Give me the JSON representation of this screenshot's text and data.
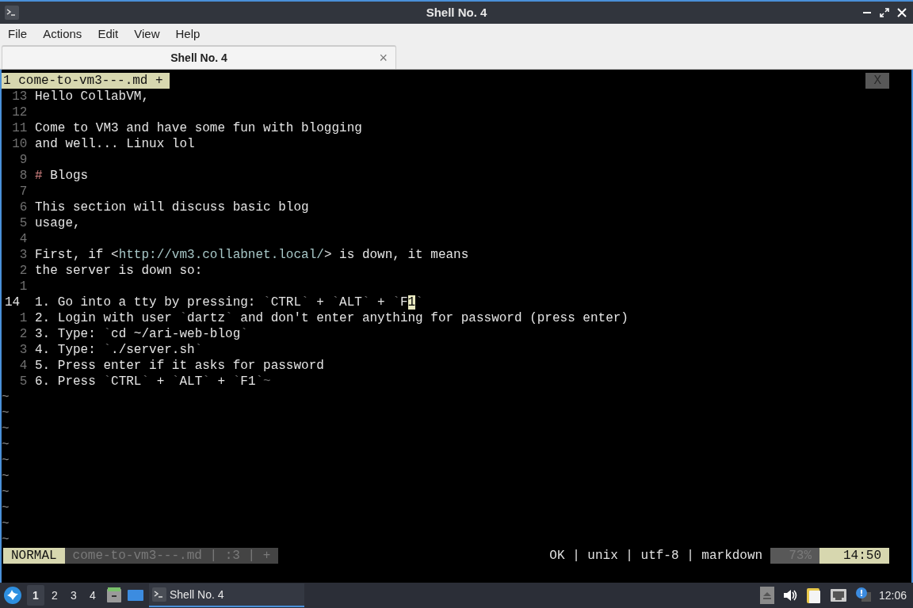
{
  "window": {
    "title": "Shell No. 4"
  },
  "menu": [
    "File",
    "Actions",
    "Edit",
    "View",
    "Help"
  ],
  "tabs": [
    {
      "label": "Shell No. 4",
      "selected": true,
      "close": "×"
    }
  ],
  "vim": {
    "buffers": [
      {
        "label": "1 come-to-vm3---.md +",
        "selected": true
      }
    ],
    "close_label": "X",
    "lines": [
      {
        "number": "13",
        "current": false,
        "segments": [
          {
            "kind": "text",
            "text": "Hello CollabVM,"
          }
        ]
      },
      {
        "number": "12",
        "current": false
      },
      {
        "number": "11",
        "current": false,
        "segments": [
          {
            "kind": "text",
            "text": "Come to VM3 and have some fun with blogging"
          }
        ]
      },
      {
        "number": "10",
        "current": false,
        "segments": [
          {
            "kind": "text",
            "text": "and well... Linux lol"
          }
        ]
      },
      {
        "number": "9",
        "current": false
      },
      {
        "number": "8",
        "current": false,
        "segments": [
          {
            "kind": "heading-mark",
            "text": "#"
          },
          {
            "kind": "text",
            "text": " Blogs"
          }
        ]
      },
      {
        "number": "7",
        "current": false
      },
      {
        "number": "6",
        "current": false,
        "segments": [
          {
            "kind": "text",
            "text": "This section will discuss basic blog"
          }
        ]
      },
      {
        "number": "5",
        "current": false,
        "segments": [
          {
            "kind": "text",
            "text": "usage,"
          }
        ]
      },
      {
        "number": "4",
        "current": false
      },
      {
        "number": "3",
        "current": false,
        "segments": [
          {
            "kind": "text",
            "text": "First, if <"
          },
          {
            "kind": "url",
            "text": "http://vm3.collabnet.local/"
          },
          {
            "kind": "text",
            "text": "> is down, it means"
          }
        ]
      },
      {
        "number": "2",
        "current": false,
        "segments": [
          {
            "kind": "text",
            "text": "the server is down so:"
          }
        ]
      },
      {
        "number": "1",
        "current": false
      },
      {
        "number": "14",
        "current": true,
        "segments": [
          {
            "kind": "text",
            "text": "1. Go into a tty by pressing: "
          },
          {
            "kind": "tick",
            "text": "`"
          },
          {
            "kind": "text",
            "text": "CTRL"
          },
          {
            "kind": "tick",
            "text": "`"
          },
          {
            "kind": "text",
            "text": " + "
          },
          {
            "kind": "tick",
            "text": "`"
          },
          {
            "kind": "text",
            "text": "ALT"
          },
          {
            "kind": "tick",
            "text": "`"
          },
          {
            "kind": "text",
            "text": " + "
          },
          {
            "kind": "tick",
            "text": "`"
          },
          {
            "kind": "text",
            "text": "F"
          },
          {
            "kind": "cursor",
            "text": "1"
          },
          {
            "kind": "tick",
            "text": "`"
          }
        ]
      },
      {
        "number": "1",
        "current": false,
        "segments": [
          {
            "kind": "text",
            "text": "2. Login with user "
          },
          {
            "kind": "tick",
            "text": "`"
          },
          {
            "kind": "text",
            "text": "dartz"
          },
          {
            "kind": "tick",
            "text": "`"
          },
          {
            "kind": "text",
            "text": " and don't enter anything for password (press enter)"
          }
        ]
      },
      {
        "number": "2",
        "current": false,
        "segments": [
          {
            "kind": "text",
            "text": "3. Type: "
          },
          {
            "kind": "tick",
            "text": "`"
          },
          {
            "kind": "text",
            "text": "cd ~/ari-web-blog"
          },
          {
            "kind": "tick",
            "text": "`"
          }
        ]
      },
      {
        "number": "3",
        "current": false,
        "segments": [
          {
            "kind": "text",
            "text": "4. Type: "
          },
          {
            "kind": "tick",
            "text": "`"
          },
          {
            "kind": "text",
            "text": "./server.sh"
          },
          {
            "kind": "tick",
            "text": "`"
          }
        ]
      },
      {
        "number": "4",
        "current": false,
        "segments": [
          {
            "kind": "text",
            "text": "5. Press enter if it asks for password"
          }
        ]
      },
      {
        "number": "5",
        "current": false,
        "segments": [
          {
            "kind": "text",
            "text": "6. Press "
          },
          {
            "kind": "tick",
            "text": "`"
          },
          {
            "kind": "text",
            "text": "CTRL"
          },
          {
            "kind": "tick",
            "text": "`"
          },
          {
            "kind": "text",
            "text": " + "
          },
          {
            "kind": "tick",
            "text": "`"
          },
          {
            "kind": "text",
            "text": "ALT"
          },
          {
            "kind": "tick",
            "text": "`"
          },
          {
            "kind": "text",
            "text": " + "
          },
          {
            "kind": "tick",
            "text": "`"
          },
          {
            "kind": "text",
            "text": "F1"
          },
          {
            "kind": "tick",
            "text": "`~"
          }
        ]
      }
    ],
    "filler": [
      "~",
      "~",
      "~",
      "~",
      "~",
      "~",
      "~",
      "~",
      "~",
      "~"
    ],
    "statusline": {
      "mode": "NORMAL",
      "file": "come-to-vm3---.md | :3 | +",
      "info": "OK | unix | utf-8 | markdown",
      "percent": "73%",
      "position": "14:50"
    }
  },
  "taskbar": {
    "workspaces": [
      {
        "label": "1",
        "selected": true
      },
      {
        "label": "2",
        "selected": false
      },
      {
        "label": "3",
        "selected": false
      },
      {
        "label": "4",
        "selected": false
      }
    ],
    "tasks": [
      {
        "label": "Shell No. 4",
        "selected": true
      }
    ],
    "clock": "12:06"
  }
}
